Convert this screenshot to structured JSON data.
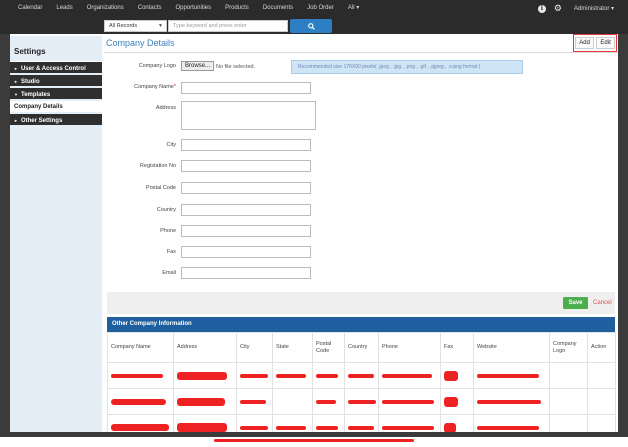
{
  "nav": {
    "items": [
      "Calendar",
      "Leads",
      "Organizations",
      "Contacts",
      "Opportunities",
      "Products",
      "Documents",
      "Job Order",
      "All ▾"
    ],
    "info_icon": "i",
    "admin_label": "Administrator ▾"
  },
  "search": {
    "scope": "All Records",
    "placeholder": "Type keyword and press enter"
  },
  "sidebar": {
    "title": "Settings",
    "items": [
      {
        "label": "User & Access Control"
      },
      {
        "label": "Studio"
      },
      {
        "label": "Templates"
      },
      {
        "label": "Company Details"
      },
      {
        "label": "Other Settings"
      }
    ]
  },
  "page": {
    "title": "Company Details",
    "add_label": "Add",
    "edit_label": "Edit"
  },
  "form": {
    "logo_label": "Company Logo",
    "browse_label": "Browse...",
    "no_file": "No file selected.",
    "hint": "Recommended size 170X60 pixels( .jpeg , .jpg , .png , .gif , .pjpeg , .x-png format )",
    "company_name_label": "Company Name",
    "required_mark": "*",
    "address_label": "Address",
    "city_label": "City",
    "registration_label": "Registation No",
    "postal_label": "Postal Code",
    "country_label": "Country",
    "phone_label": "Phone",
    "fax_label": "Fax",
    "email_label": "Email",
    "save_label": "Save",
    "cancel_label": "Cancel"
  },
  "table": {
    "title": "Other Company Information",
    "headers": [
      "Company Name",
      "Address",
      "City",
      "State",
      "Postal Code",
      "Country",
      "Phone",
      "Fax",
      "Website",
      "Company Logo",
      "Action"
    ],
    "redacted_rows": 3
  },
  "colors": {
    "accent": "#2d7fc4",
    "save": "#4cae4c",
    "cancel": "#d9534f",
    "header": "#1f5f9f",
    "redaction": "#e22222"
  }
}
